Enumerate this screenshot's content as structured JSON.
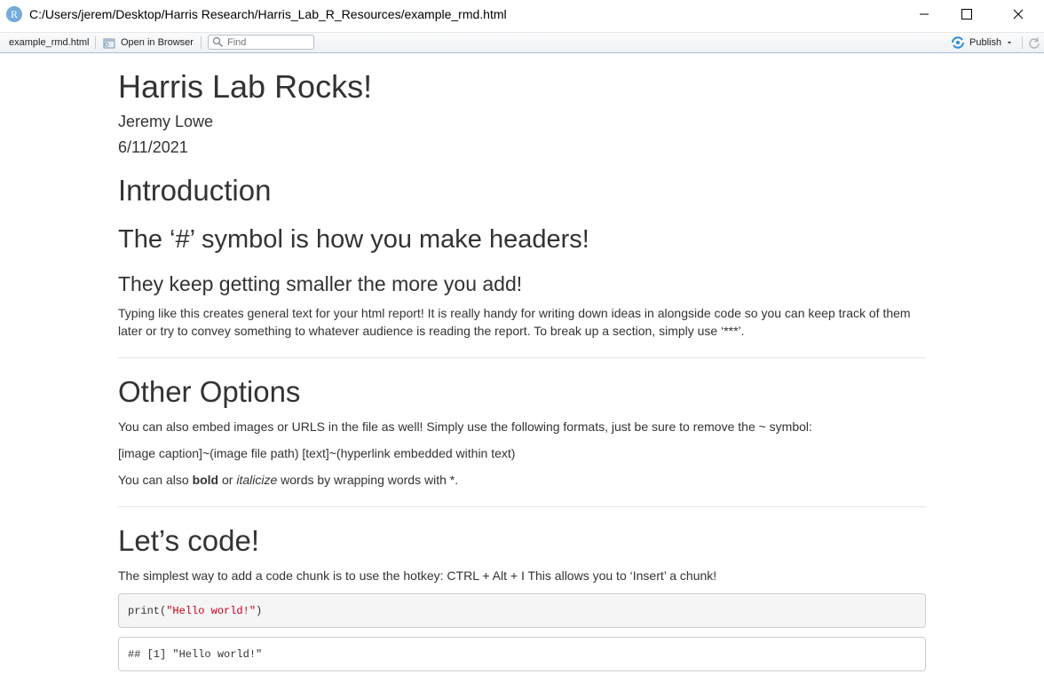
{
  "window": {
    "app_icon_letter": "R",
    "title": "C:/Users/jerem/Desktop/Harris Research/Harris_Lab_R_Resources/example_rmd.html"
  },
  "toolbar": {
    "file_name": "example_rmd.html",
    "open_in_browser": "Open in Browser",
    "find_placeholder": "Find",
    "publish": "Publish"
  },
  "doc": {
    "title": "Harris Lab Rocks!",
    "author": "Jeremy Lowe",
    "date": "6/11/2021",
    "section1": {
      "h1": "Introduction",
      "h2": "The ‘#’ symbol is how you make headers!",
      "h3": "They keep getting smaller the more you add!",
      "para": "Typing like this creates general text for your html report! It is really handy for writing down ideas in alongside code so you can keep track of them later or try to convey something to whatever audience is reading the report. To break up a section, simply use ‘***’."
    },
    "section2": {
      "h1": "Other Options",
      "para1": "You can also embed images or URLS in the file as well! Simply use the following formats, just be sure to remove the ~ symbol:",
      "para2": "[image caption]~(image file path) [text]~(hyperlink embedded within text)",
      "para3_pre": "You can also ",
      "para3_bold": "bold",
      "para3_mid": " or ",
      "para3_italic": "italicize",
      "para3_post": " words by wrapping words with *."
    },
    "section3": {
      "h1": "Let’s code!",
      "para": "The simplest way to add a code chunk is to use the hotkey: CTRL + Alt + I This allows you to ‘Insert’ a chunk!",
      "code_fn": "print(",
      "code_str": "\"Hello world!\"",
      "code_close": ")",
      "output": "## [1] \"Hello world!\""
    }
  },
  "colors": {
    "accent": "#75aadb",
    "code_string": "#c4001a",
    "text": "#333333"
  }
}
